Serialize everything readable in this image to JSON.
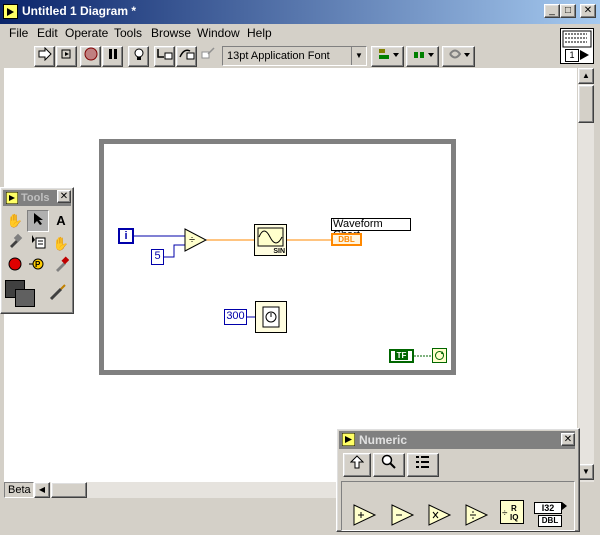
{
  "window": {
    "title": "Untitled 1 Diagram *",
    "minimize": "_",
    "maximize": "□",
    "close": "✕"
  },
  "menu": {
    "items": [
      {
        "label": "File"
      },
      {
        "label": "Edit"
      },
      {
        "label": "Operate"
      },
      {
        "label": "Tools"
      },
      {
        "label": "Browse"
      },
      {
        "label": "Window"
      },
      {
        "label": "Help"
      }
    ]
  },
  "toolbar": {
    "font_selector": "13pt Application Font",
    "icons": [
      "run-arrow-icon",
      "run-continuously-icon",
      "abort-icon",
      "pause-icon",
      "highlight-execution-icon",
      "step-into-icon",
      "step-over-icon",
      "step-out-icon",
      "align-objects-icon",
      "distribute-objects-icon",
      "reorder-icon"
    ]
  },
  "connector_pane": {
    "label": "1"
  },
  "diagram": {
    "iteration_label": "i",
    "divisor_constant": "5",
    "chart_terminal_label": "Waveform Chart",
    "chart_terminal_type": "DBL",
    "sine_label": "SIN",
    "wait_constant": "300",
    "stop_terminal_type": "TF"
  },
  "tools_palette": {
    "title": "Tools",
    "close": "✕",
    "tools": [
      "operate-value-icon",
      "position-select-icon",
      "edit-text-icon",
      "connect-wire-icon",
      "object-shortcut-menu-icon",
      "scroll-window-icon",
      "set-breakpoint-icon",
      "probe-data-icon",
      "get-color-icon",
      "set-color-icon"
    ]
  },
  "numeric_palette": {
    "title": "Numeric",
    "close": "✕",
    "nav_buttons": [
      "up-icon",
      "search-icon",
      "options-icon"
    ],
    "functions": [
      "add-icon",
      "subtract-icon",
      "multiply-icon",
      "divide-icon",
      "quotient-remainder-icon",
      "conversion-icon"
    ],
    "conversion_type": "I32",
    "conversion_sub": "DBL",
    "quotient_label": "R\nIQ"
  },
  "status": {
    "left_label": "Beta"
  },
  "colors": {
    "titlebar_start": "#0a246a",
    "titlebar_end": "#a6caf0",
    "numeric_wire": "#ff8800",
    "integer_wire": "#0000aa",
    "boolean_wire": "#006600"
  }
}
